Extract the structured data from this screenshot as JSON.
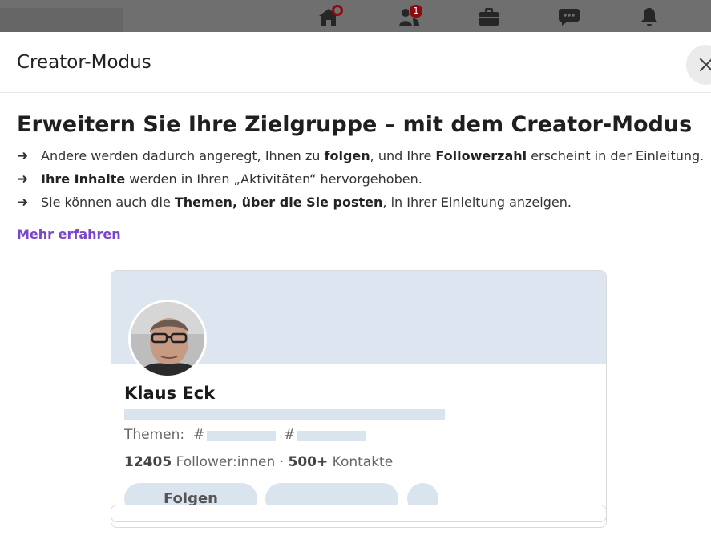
{
  "nav": {
    "home_badge": "",
    "network_badge": "1",
    "icons": [
      "home-icon",
      "my-network-icon",
      "jobs-icon",
      "messaging-icon",
      "notifications-icon"
    ]
  },
  "modal": {
    "title": "Creator-Modus",
    "heading": "Erweitern Sie Ihre Zielgruppe – mit dem Creator-Modus",
    "bullets": [
      {
        "pre": "Andere werden dadurch angeregt, Ihnen zu ",
        "b1": "folgen",
        "mid": ", und Ihre ",
        "b2": "Followerzahl",
        "post": " erscheint in der Einleitung."
      },
      {
        "pre": "",
        "b1": "Ihre Inhalte",
        "mid": " werden in Ihren „Aktivitäten“ hervorgehoben.",
        "b2": "",
        "post": ""
      },
      {
        "pre": "Sie können auch die ",
        "b1": "Themen, über die Sie posten",
        "mid": ", in Ihrer Einleitung anzeigen.",
        "b2": "",
        "post": ""
      }
    ],
    "learn_more": "Mehr erfahren"
  },
  "preview": {
    "name": "Klaus Eck",
    "themes_label": "Themen:",
    "hash": "#",
    "followers_count": "12405",
    "followers_label": "Follower:innen",
    "separator": "·",
    "connections_count": "500+",
    "connections_label": "Kontakte",
    "follow_button": "Folgen"
  },
  "colors": {
    "accent": "#7b45c9",
    "banner": "#dde6f0",
    "placeholder": "#dae4ef",
    "badge": "#8a0c10"
  }
}
